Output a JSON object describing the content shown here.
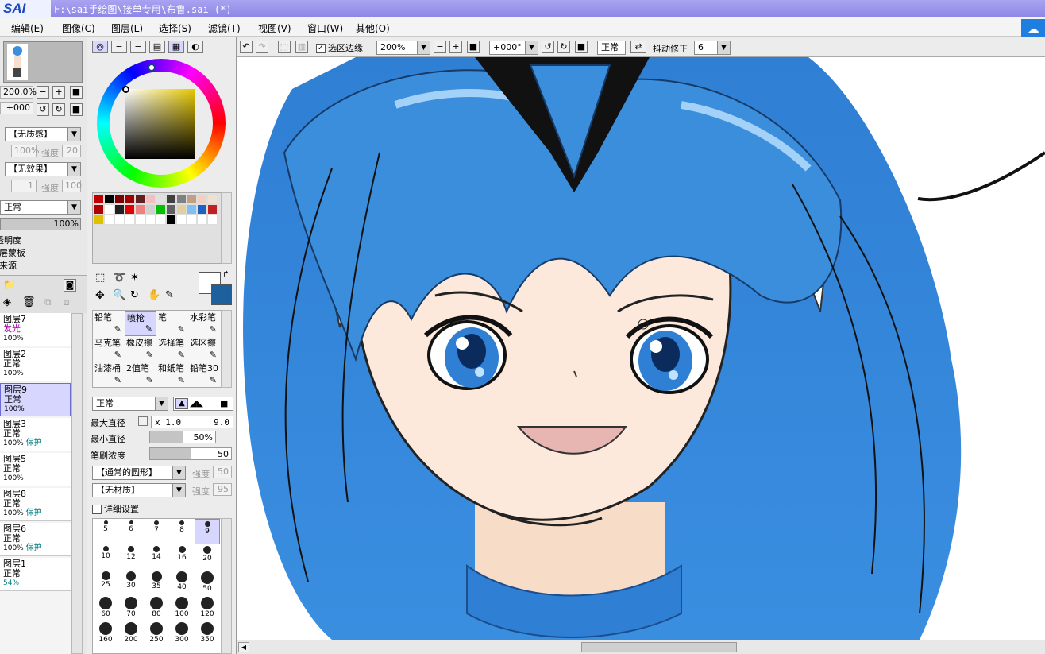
{
  "app": {
    "logo": "SAI",
    "title": "F:\\sai手绘图\\接单专用\\布鲁.sai (*)"
  },
  "menu": [
    "编辑(E)",
    "图像(C)",
    "图层(L)",
    "选择(S)",
    "滤镜(T)",
    "视图(V)",
    "窗口(W)",
    "其他(O)"
  ],
  "navigator": {
    "zoom": "200.0%",
    "angle": "+000"
  },
  "texture": {
    "paper": "【无质感】",
    "paper_value": "100%",
    "paper_strength_label": "强度",
    "paper_strength": "20",
    "effect": "【无效果】",
    "effect_value": "1",
    "effect_strength_label": "强度",
    "effect_strength": "100"
  },
  "blend": {
    "mode": "正常",
    "opacity": "100%"
  },
  "layer_options": [
    "透明度",
    "图层蒙板",
    "取来源"
  ],
  "layers": [
    {
      "name": "图层7",
      "mode": "发光",
      "opacity": "100%",
      "protect": "",
      "selected": false
    },
    {
      "name": "图层2",
      "mode": "正常",
      "opacity": "100%",
      "protect": "",
      "selected": false
    },
    {
      "name": "图层9",
      "mode": "正常",
      "opacity": "100%",
      "protect": "",
      "selected": true
    },
    {
      "name": "图层3",
      "mode": "正常",
      "opacity": "100%",
      "protect": "保护",
      "selected": false
    },
    {
      "name": "图层5",
      "mode": "正常",
      "opacity": "100%",
      "protect": "",
      "selected": false
    },
    {
      "name": "图层8",
      "mode": "正常",
      "opacity": "100%",
      "protect": "保护",
      "selected": false
    },
    {
      "name": "图层6",
      "mode": "正常",
      "opacity": "100%",
      "protect": "保护",
      "selected": false
    },
    {
      "name": "图层1",
      "mode": "正常",
      "opacity": "54%",
      "protect": "",
      "selected": false
    }
  ],
  "colors": {
    "primary": "#ffffff",
    "secondary": "#1e5f9e",
    "accent": "#8e86e6",
    "hair": "#3b8edb"
  },
  "swatches": [
    "#c00000",
    "#000000",
    "#800000",
    "#a00000",
    "#602020",
    "#f0c0c0",
    "#e0e0e0",
    "#404040",
    "#808080",
    "#c0a080",
    "#f0d0c0",
    "#f0e0d0",
    "#b00000",
    "#ffffff",
    "#202020",
    "#e00000",
    "#f08080",
    "#d0d0d0",
    "#00c000",
    "#606060",
    "#e0d0a0",
    "#80c0f0",
    "#2060c0",
    "#c02020",
    "#e0c000",
    "#ffffff",
    "#ffffff",
    "#ffffff",
    "#ffffff",
    "#ffffff",
    "#ffffff",
    "#000000",
    "#ffffff",
    "#ffffff",
    "#ffffff",
    "#ffffff"
  ],
  "tools": [
    {
      "label": "铅笔",
      "selected": false
    },
    {
      "label": "喷枪",
      "selected": true
    },
    {
      "label": "笔",
      "selected": false
    },
    {
      "label": "水彩笔",
      "selected": false
    },
    {
      "label": "马克笔",
      "selected": false
    },
    {
      "label": "橡皮擦",
      "selected": false
    },
    {
      "label": "选择笔",
      "selected": false
    },
    {
      "label": "选区擦",
      "selected": false
    },
    {
      "label": "油漆桶",
      "selected": false
    },
    {
      "label": "2值笔",
      "selected": false
    },
    {
      "label": "和纸笔",
      "selected": false
    },
    {
      "label": "铅笔30",
      "selected": false
    }
  ],
  "brush": {
    "mode": "正常",
    "max_size_label": "最大直径",
    "max_size_mult": "x 1.0",
    "max_size": "9.0",
    "min_size_label": "最小直径",
    "min_size": "50%",
    "min_size_fill": 0.5,
    "density_label": "笔刷浓度",
    "density": "50",
    "density_fill": 0.5,
    "shape": "【通常的圆形】",
    "shape_strength_label": "强度",
    "shape_strength": "50",
    "texture": "【无材质】",
    "texture_strength_label": "强度",
    "texture_strength": "95",
    "details_label": "详细设置"
  },
  "brush_sizes": [
    "5",
    "6",
    "7",
    "8",
    "9",
    "10",
    "12",
    "14",
    "16",
    "20",
    "25",
    "30",
    "35",
    "40",
    "50",
    "60",
    "70",
    "80",
    "100",
    "120",
    "160",
    "200",
    "250",
    "300",
    "350"
  ],
  "brush_selected": "9",
  "toolbar": {
    "select_edge_label": "选区边缘",
    "select_edge_checked": true,
    "zoom": "200%",
    "angle": "+000°",
    "blend": "正常",
    "stabilizer_label": "抖动修正",
    "stabilizer": "6"
  }
}
